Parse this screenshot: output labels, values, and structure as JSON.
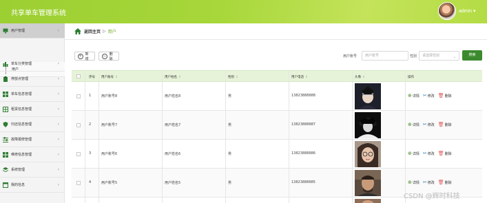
{
  "header": {
    "title": "共享单车管理系统",
    "user": "admin ▾"
  },
  "sidebar": {
    "items": [
      {
        "label": "用户管理",
        "icon": "monitor-icon",
        "arrow": "›"
      },
      {
        "label": "单车分类管理",
        "icon": "bar-chart-icon",
        "arrow": "›"
      },
      {
        "label": "停放点管理",
        "icon": "clipboard-icon",
        "arrow": "›"
      },
      {
        "label": "单车信息管理",
        "icon": "grid-icon",
        "arrow": "›"
      },
      {
        "label": "租赁信息管理",
        "icon": "table-icon",
        "arrow": "›"
      },
      {
        "label": "归还信息管理",
        "icon": "shield-icon",
        "arrow": "›"
      },
      {
        "label": "故障报修管理",
        "icon": "sliders-icon",
        "arrow": "›"
      },
      {
        "label": "维修信息管理",
        "icon": "grid-icon",
        "arrow": "›"
      },
      {
        "label": "系统管理",
        "icon": "layers-icon",
        "arrow": "›"
      },
      {
        "label": "我的信息",
        "icon": "window-icon",
        "arrow": "›"
      }
    ],
    "sub_item": "用户"
  },
  "breadcrumb": {
    "home": "返回主页",
    "sep": "▷",
    "current": "用户"
  },
  "toolbar": {
    "add_label": "新增",
    "delete_label": "删除",
    "search_account_label": "用户账号",
    "search_account_placeholder": "用户账号",
    "search_gender_label": "性别",
    "search_gender_placeholder": "请选择性别",
    "search_button": "搜索"
  },
  "table": {
    "columns": [
      "序号",
      "用户账号",
      "用户姓名",
      "性别",
      "用户电话",
      "头像",
      "操作"
    ],
    "rows": [
      {
        "index": "1",
        "account": "用户账号8",
        "name": "用户姓名8",
        "gender": "男",
        "phone": "13823888888"
      },
      {
        "index": "2",
        "account": "用户账号7",
        "name": "用户姓名7",
        "gender": "男",
        "phone": "13823888887"
      },
      {
        "index": "3",
        "account": "用户账号6",
        "name": "用户姓名6",
        "gender": "男",
        "phone": "13823888886"
      },
      {
        "index": "4",
        "account": "用户账号5",
        "name": "用户姓名5",
        "gender": "男",
        "phone": "13823888885"
      }
    ],
    "ops": {
      "detail": "详情",
      "edit": "修改",
      "delete": "删除"
    }
  },
  "watermark": "CSDN @辉时科技",
  "colors": {
    "header": "#a7d73a",
    "accent": "#6aa61f",
    "search_btn": "#3c8a2e",
    "table_head": "#e6f3d8",
    "delete": "#e05656"
  }
}
